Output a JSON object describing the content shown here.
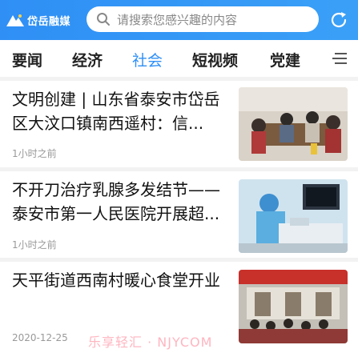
{
  "header": {
    "logo_text": "岱岳融媒",
    "search_placeholder": "请搜索您感兴趣的内容",
    "accent": "#2f8ff5"
  },
  "tabs": [
    {
      "label": "要闻",
      "active": false
    },
    {
      "label": "经济",
      "active": false
    },
    {
      "label": "社会",
      "active": true
    },
    {
      "label": "短视频",
      "active": false
    },
    {
      "label": "党建",
      "active": false
    }
  ],
  "news": [
    {
      "title": "文明创建 | 山东省泰安市岱岳区大汶口镇南西遥村：信...",
      "meta": "1小时之前",
      "image": "group-meeting-photo"
    },
    {
      "title": "不开刀治疗乳腺多发结节——泰安市第一人民医院开展超...",
      "meta": "1小时之前",
      "image": "ultrasound-procedure-photo"
    },
    {
      "title": "天平街道西南村暖心食堂开业",
      "meta": "2020-12-25",
      "image": "canteen-opening-photo"
    }
  ],
  "watermark": "乐享轻汇 · NJYCOM"
}
